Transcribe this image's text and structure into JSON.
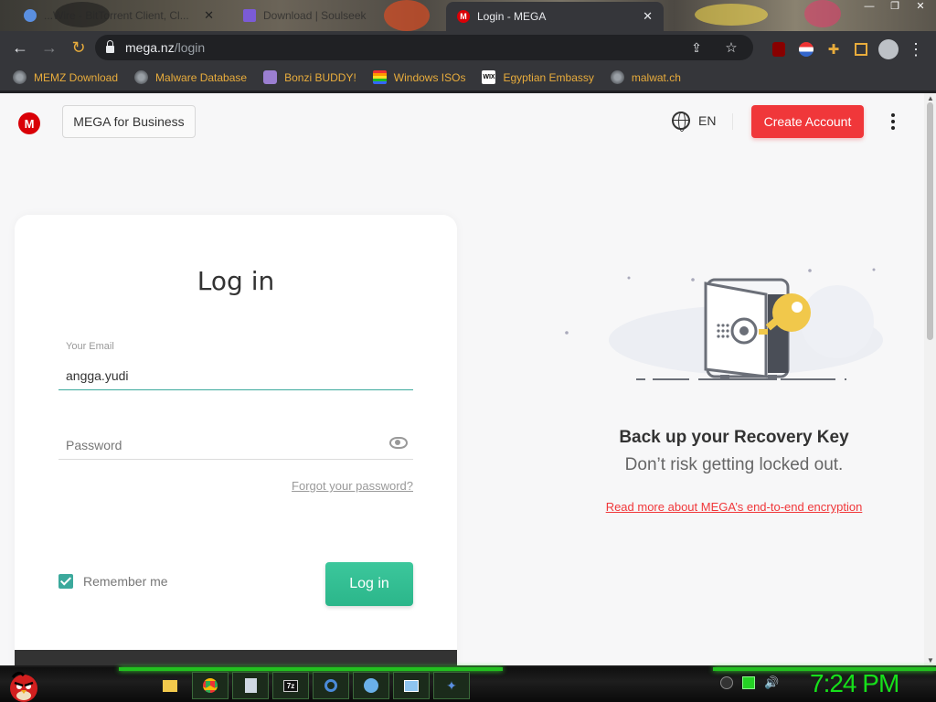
{
  "tabs": [
    {
      "label": "...Wire - BitTorrent Client, Cl...",
      "state": "inactive"
    },
    {
      "label": "Download | Soulseek",
      "state": "inactive"
    },
    {
      "label": "Login - MEGA",
      "state": "active",
      "favicon": "M"
    }
  ],
  "address": {
    "host": "mega.nz",
    "path": "/login"
  },
  "bookmarks": [
    {
      "label": "MEMZ Download",
      "icon": "globe-icon"
    },
    {
      "label": "Malware Database",
      "icon": "globe-icon"
    },
    {
      "label": "Bonzi BUDDY!",
      "icon": "bonzi-icon"
    },
    {
      "label": "Windows ISOs",
      "icon": "rainbow-icon"
    },
    {
      "label": "Egyptian Embassy",
      "icon": "wix-icon"
    },
    {
      "label": "malwat.ch",
      "icon": "globe-icon"
    }
  ],
  "header": {
    "logo": "M",
    "business_label": "MEGA for Business",
    "language": "EN",
    "create_account_label": "Create Account"
  },
  "login": {
    "title": "Log in",
    "email_label": "Your Email",
    "email_value": "angga.yudi",
    "password_placeholder": "Password",
    "forgot_label": "Forgot your password?",
    "remember_label": "Remember me",
    "remember_checked": true,
    "submit_label": "Log in"
  },
  "promo": {
    "title": "Back up your Recovery Key",
    "subtitle": "Don’t risk getting locked out.",
    "link": "Read more about MEGA’s end-to-end encryption"
  },
  "taskbar": {
    "clock": "7:24 PM",
    "apps": [
      "folder-icon",
      "chrome-icon",
      "notepad-icon",
      "7zip-icon",
      "search-icon",
      "settings-icon",
      "window-icon",
      "bird-icon"
    ]
  },
  "colors": {
    "accent_red": "#f0373a",
    "accent_green": "#3ba99c",
    "mega_red": "#d90007",
    "taskbar_green": "#16e01a"
  }
}
